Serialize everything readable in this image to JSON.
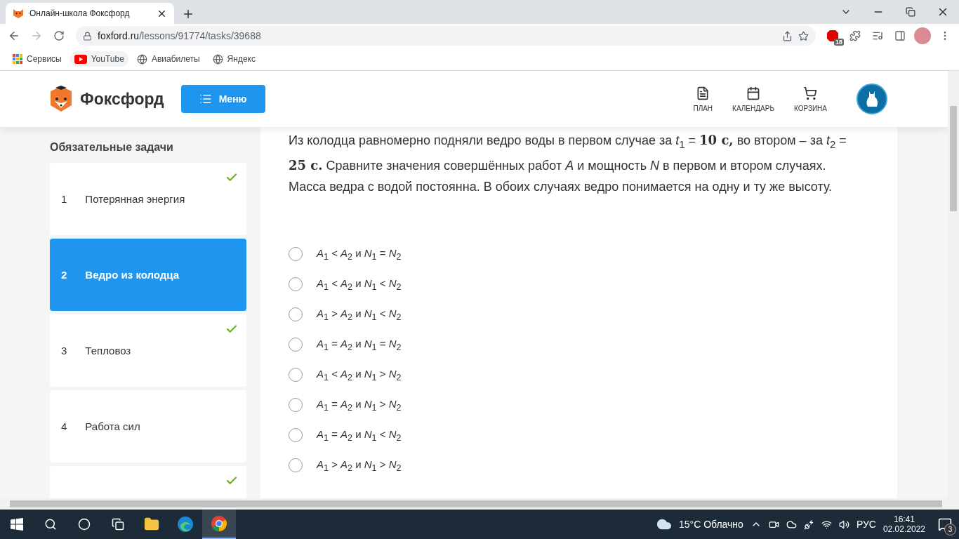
{
  "browser": {
    "tab_title": "Онлайн-школа Фоксфорд",
    "url_host": "foxford.ru",
    "url_path": "/lessons/91774/tasks/39688",
    "extension_badge": "18",
    "bookmarks": [
      {
        "label": "Сервисы",
        "kind": "apps"
      },
      {
        "label": "YouTube",
        "kind": "youtube"
      },
      {
        "label": "Авиабилеты",
        "kind": "globe"
      },
      {
        "label": "Яндекс",
        "kind": "globe"
      }
    ]
  },
  "header": {
    "logo_text": "Фоксфорд",
    "menu_button": "Меню",
    "nav": [
      {
        "label": "ПЛАН",
        "kind": "plan"
      },
      {
        "label": "КАЛЕНДАРЬ",
        "kind": "calendar"
      },
      {
        "label": "КОРЗИНА",
        "kind": "cart"
      }
    ]
  },
  "sidebar": {
    "title": "Обязательные задачи",
    "tasks": [
      {
        "number": "1",
        "title": "Потерянная энергия",
        "checked": true,
        "selected": false
      },
      {
        "number": "2",
        "title": "Ведро из колодца",
        "checked": false,
        "selected": true
      },
      {
        "number": "3",
        "title": "Тепловоз",
        "checked": true,
        "selected": false
      },
      {
        "number": "4",
        "title": "Работа сил",
        "checked": false,
        "selected": false
      },
      {
        "checked": true,
        "selected": false
      }
    ]
  },
  "question": "Из колодца равномерно подняли ведро воды в первом случае за *t*$_{1}$ = **10 с,** во втором – за *t*$_{2}$ = **25 с.** Сравните значения совершённых работ *A* и мощность *N* в первом и втором случаях. Масса ведра с водой постоянна. В обоих случаях ведро понимается на одну и ту же высоту.",
  "options": [
    {
      "text": "*A*$_{1}$ < *A*$_{2}$ и *N*$_{1}$ = *N*$_{2}$",
      "selected": false
    },
    {
      "text": "*A*$_{1}$ < *A*$_{2}$ и *N*$_{1}$ < *N*$_{2}$",
      "selected": false
    },
    {
      "text": "*A*$_{1}$ > *A*$_{2}$ и *N*$_{1}$ < *N*$_{2}$",
      "selected": false
    },
    {
      "text": "*A*$_{1}$ = *A*$_{2}$ и *N*$_{1}$ = *N*$_{2}$",
      "selected": false
    },
    {
      "text": "*A*$_{1}$ < *A*$_{2}$ и *N*$_{1}$ > *N*$_{2}$",
      "selected": false
    },
    {
      "text": "*A*$_{1}$ = *A*$_{2}$ и *N*$_{1}$ > *N*$_{2}$",
      "selected": false
    },
    {
      "text": "*A*$_{1}$ = *A*$_{2}$ и *N*$_{1}$ < *N*$_{2}$",
      "selected": false
    },
    {
      "text": "*A*$_{1}$ > *A*$_{2}$ и *N*$_{1}$ > *N*$_{2}$",
      "selected": false
    }
  ],
  "taskbar": {
    "weather": "15°C  Облачно",
    "language": "РУС",
    "time": "16:41",
    "date": "02.02.2022",
    "notifications": "3"
  }
}
